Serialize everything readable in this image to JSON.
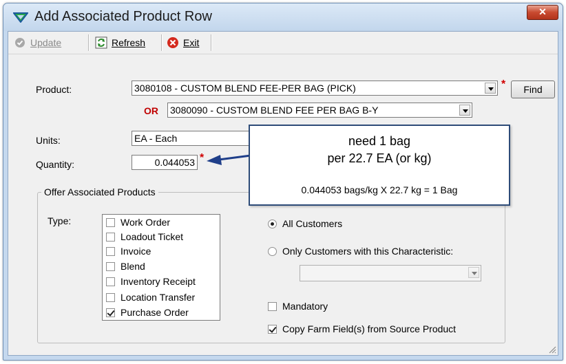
{
  "window": {
    "title": "Add Associated Product Row",
    "close_label": "✕"
  },
  "toolbar": {
    "update_label": "Update",
    "refresh_label": "Refresh",
    "exit_label": "Exit"
  },
  "form": {
    "product_label": "Product:",
    "product_value": "3080108 - CUSTOM BLEND FEE-PER BAG (PICK)",
    "find_label": "Find",
    "or_label": "OR",
    "alt_product_value": "3080090 - CUSTOM BLEND FEE PER BAG B-Y",
    "units_label": "Units:",
    "units_value": "EA - Each",
    "quantity_label": "Quantity:",
    "quantity_value": "0.044053",
    "required_marker": "*"
  },
  "offer": {
    "group_title": "Offer Associated Products",
    "type_label": "Type:",
    "types": [
      {
        "label": "Work Order",
        "checked": false
      },
      {
        "label": "Loadout Ticket",
        "checked": false
      },
      {
        "label": "Invoice",
        "checked": false
      },
      {
        "label": "Blend",
        "checked": false
      },
      {
        "label": "Inventory Receipt",
        "checked": false
      },
      {
        "label": "Location Transfer",
        "checked": false
      },
      {
        "label": "Purchase Order",
        "checked": true
      }
    ],
    "all_customers_label": "All Customers",
    "only_customers_label": "Only Customers with this Characteristic:",
    "characteristic_value": "",
    "mandatory_label": "Mandatory",
    "copy_farm_label": "Copy Farm Field(s) from Source Product"
  },
  "callout": {
    "line1": "need 1 bag",
    "line2": "per 22.7 EA (or kg)",
    "line3": "0.044053 bags/kg X 22.7 kg = 1 Bag"
  },
  "colors": {
    "required": "#d00000",
    "or_label": "#c00000",
    "callout_border": "#2d4b78",
    "arrow": "#1f3f8a"
  }
}
